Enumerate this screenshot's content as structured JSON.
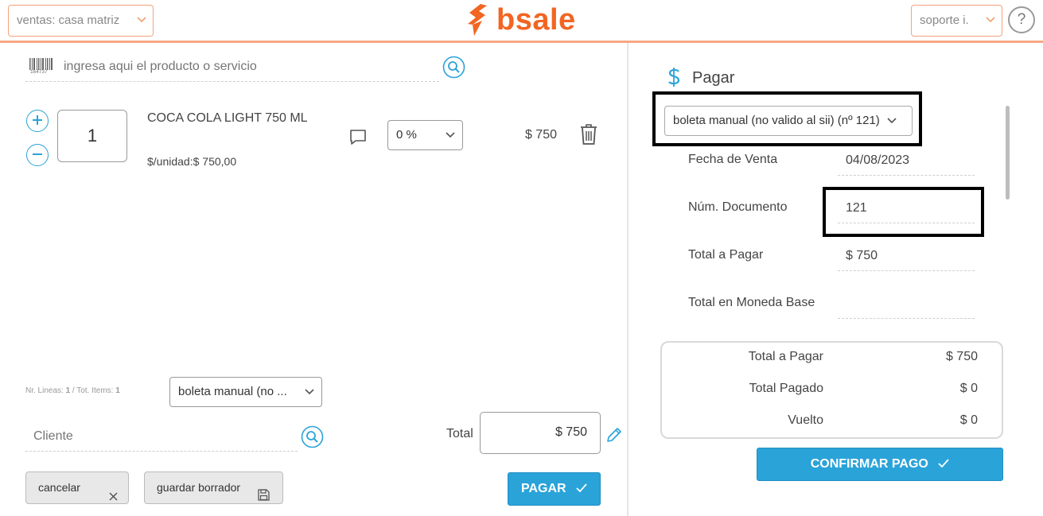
{
  "header": {
    "branch_select": "ventas: casa matriz",
    "brand": "bsale",
    "user_select": "soporte i.",
    "help": "?"
  },
  "product_search": {
    "placeholder": "ingresa aqui el producto o servicio",
    "barcode_number": "164737"
  },
  "line_item": {
    "quantity": "1",
    "name": "COCA COLA LIGHT 750 ML",
    "unit_price": "$/unidad:$ 750,00",
    "discount": "0 %",
    "amount": "$ 750"
  },
  "summary_left": {
    "lines_label": "Nr. Lineas: ",
    "lines_value": "1",
    "items_label": " / Tot. Items: ",
    "items_value": "1",
    "doc_type": "boleta manual (no ...",
    "client_placeholder": "Cliente",
    "total_label": "Total",
    "total_value": "$ 750",
    "cancel_label": "cancelar",
    "save_draft_label": "guardar borrador",
    "pay_label": "PAGAR"
  },
  "payment": {
    "title": "Pagar",
    "doc_select": "boleta manual (no valido al sii) (nº 121)",
    "fields": [
      {
        "label": "Fecha de Venta",
        "value": "04/08/2023"
      },
      {
        "label": "Núm. Documento",
        "value": "121"
      },
      {
        "label": "Total a Pagar",
        "value": "$ 750"
      },
      {
        "label": "Total en Moneda Base",
        "value": ""
      }
    ],
    "totals": [
      {
        "label": "Total a Pagar",
        "value": "$ 750"
      },
      {
        "label": "Total Pagado",
        "value": "$ 0"
      },
      {
        "label": "Vuelto",
        "value": "$ 0"
      }
    ],
    "confirm_label": "CONFIRMAR PAGO"
  },
  "colors": {
    "brand": "#f26522",
    "accent": "#2aa3d9",
    "highlight_border": "#000000"
  }
}
